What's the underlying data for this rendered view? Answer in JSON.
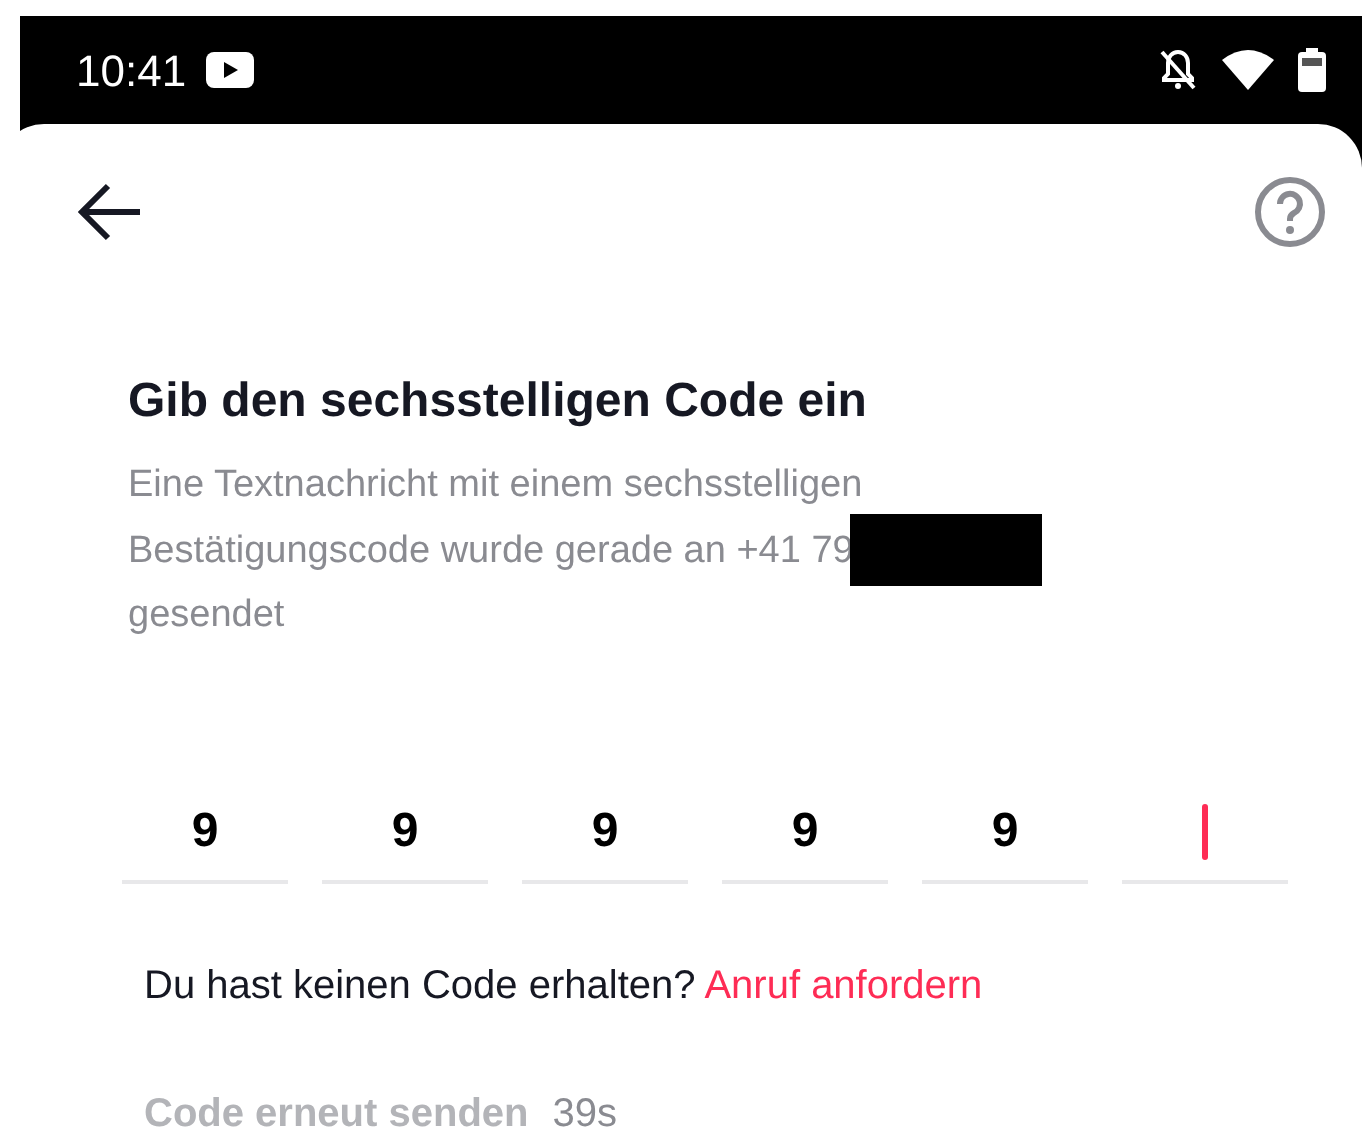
{
  "status_bar": {
    "time": "10:41"
  },
  "title": "Gib den sechsstelligen Code ein",
  "description": {
    "line_1": "Eine Textnachricht mit einem sechsstelligen",
    "line_2": "Bestätigungscode wurde gerade an +41 79",
    "redacted": true,
    "line_3": "gesendet"
  },
  "code_fields": [
    {
      "value": "9",
      "focused": false
    },
    {
      "value": "9",
      "focused": false
    },
    {
      "value": "9",
      "focused": false
    },
    {
      "value": "9",
      "focused": false
    },
    {
      "value": "9",
      "focused": false
    },
    {
      "focused": true
    }
  ],
  "no_code": {
    "question": "Du hast keinen Code erhalten?",
    "link": "Anruf anfordern"
  },
  "resend": {
    "label": "Code erneut senden",
    "disabled": true,
    "countdown": "39s"
  }
}
